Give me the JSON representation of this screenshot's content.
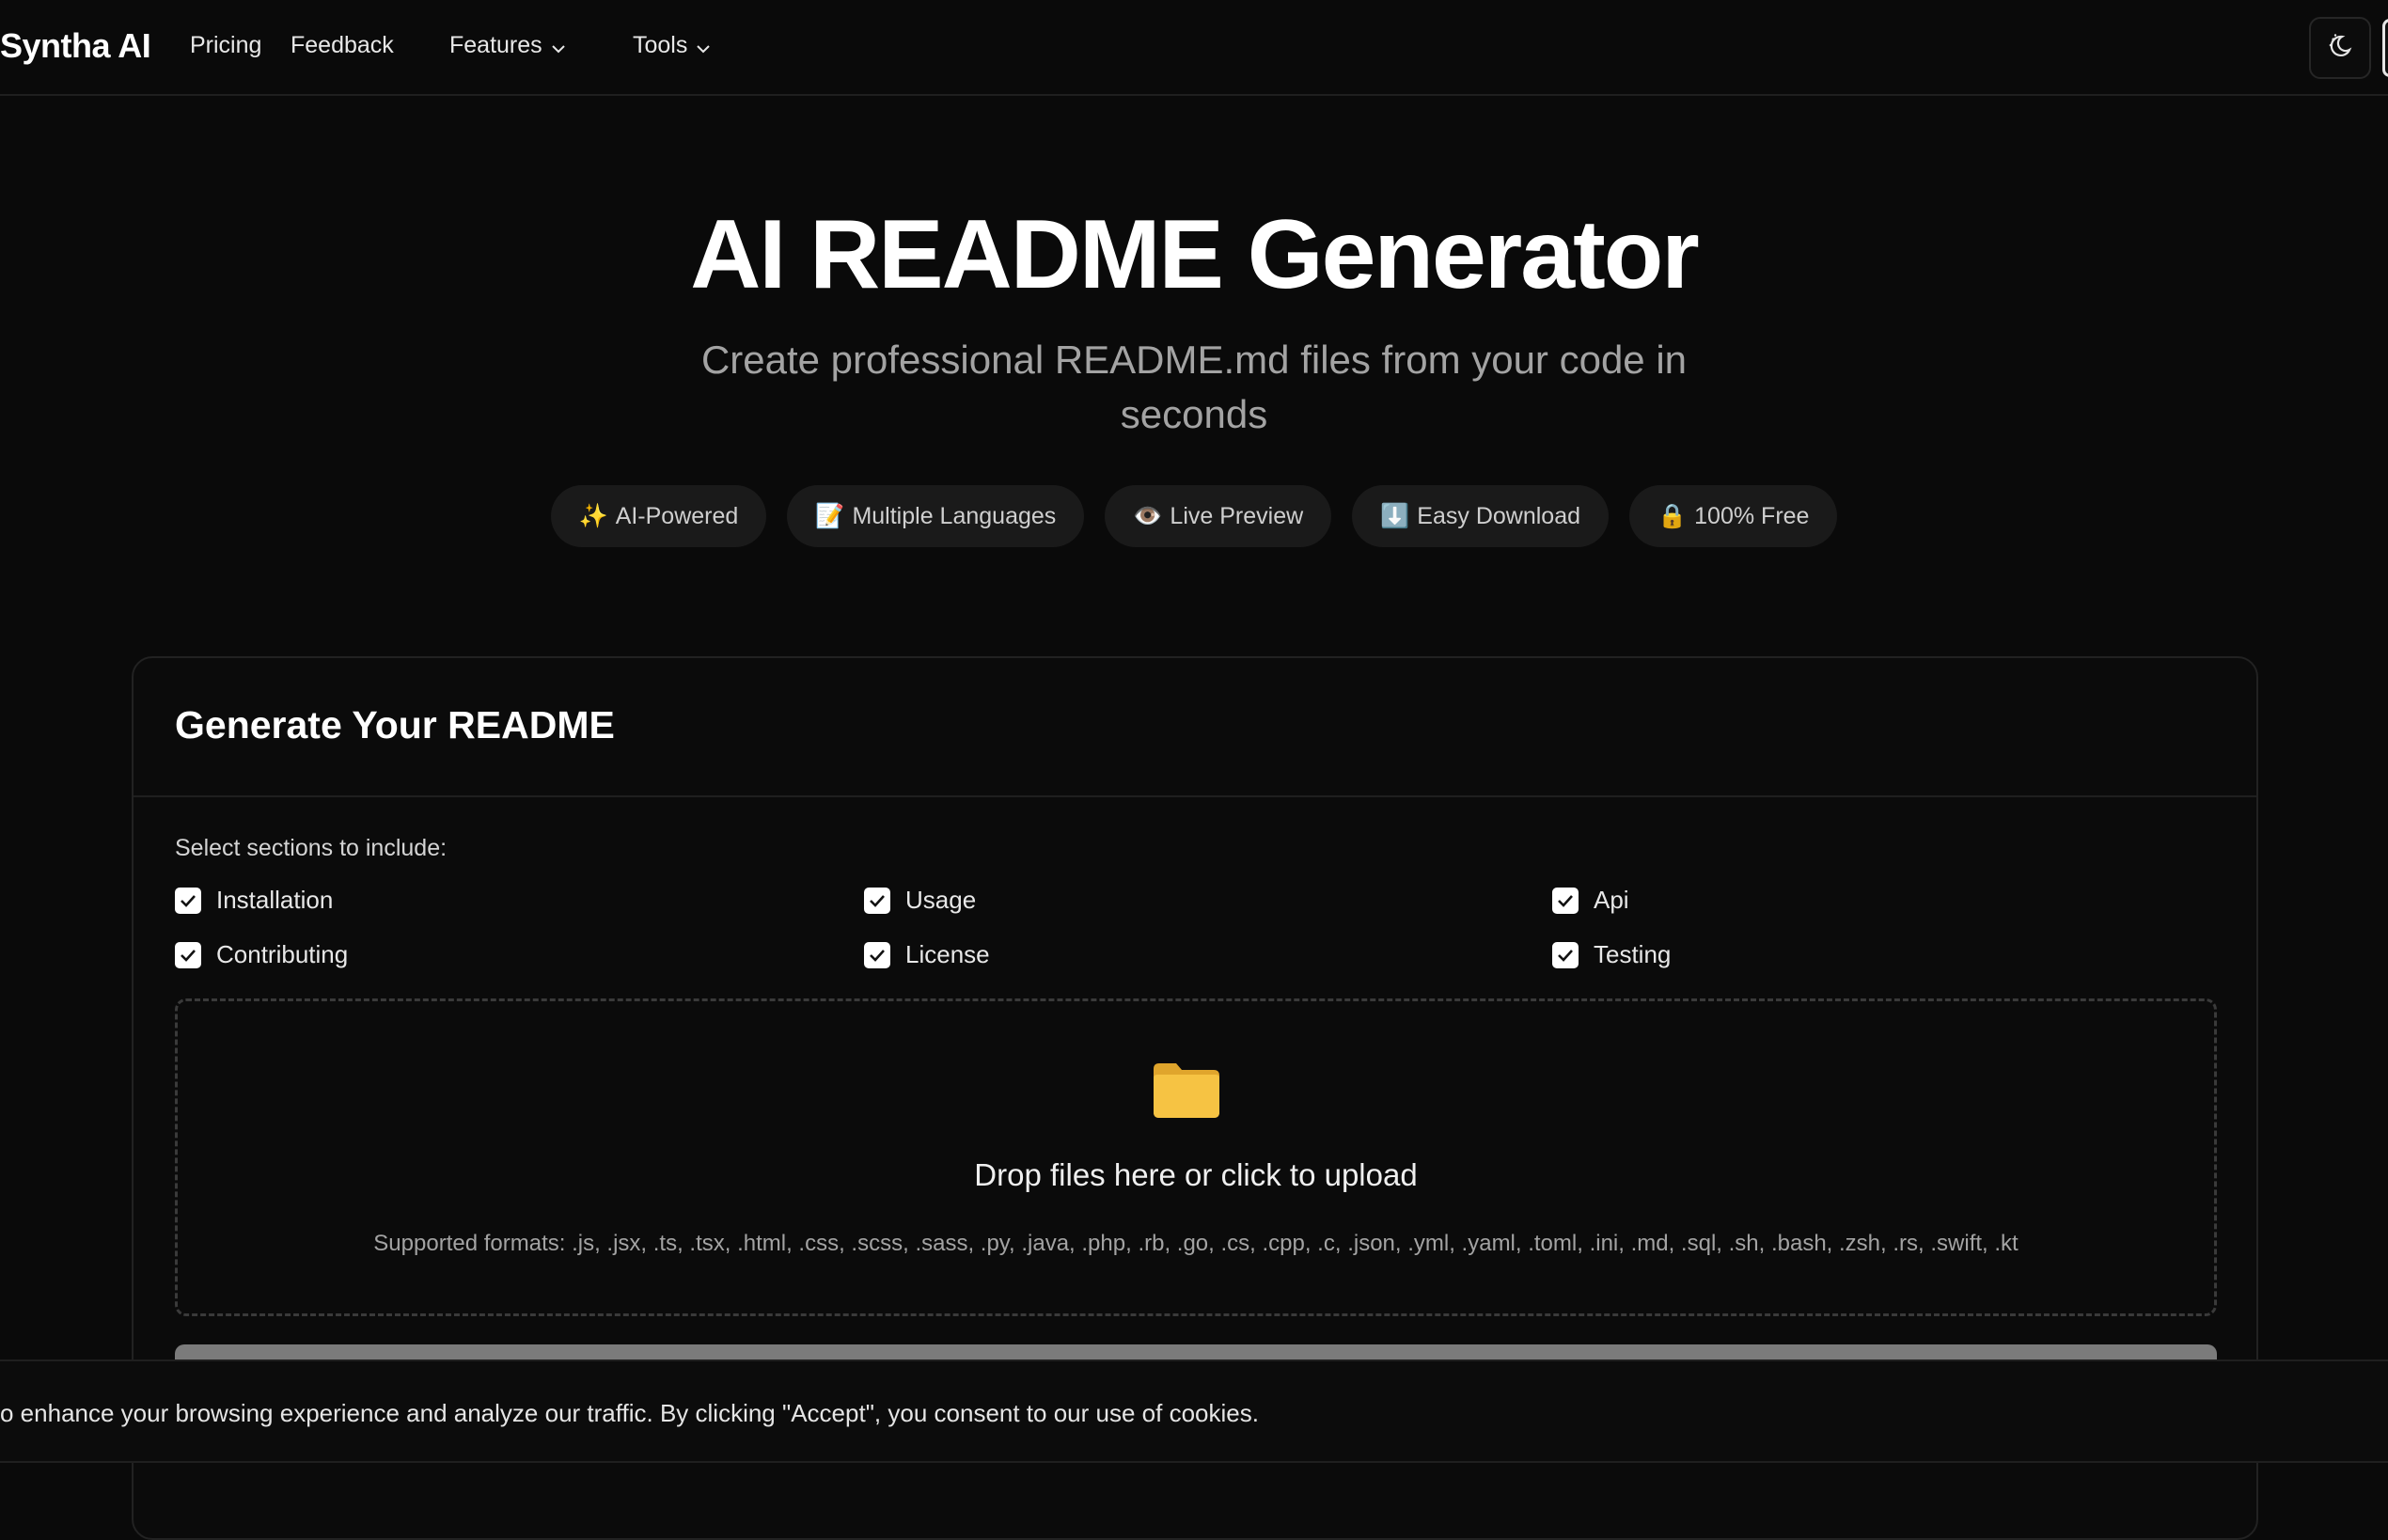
{
  "nav": {
    "brand": "Syntha AI",
    "links": {
      "pricing": "Pricing",
      "feedback": "Feedback",
      "features": "Features",
      "tools": "Tools"
    },
    "theme_toggle_icon": "moon-sun-icon"
  },
  "hero": {
    "title": "AI README Generator",
    "subtitle": "Create professional README.md files from your code in seconds",
    "pills": [
      {
        "emoji": "✨",
        "label": "AI-Powered"
      },
      {
        "emoji": "📝",
        "label": "Multiple Languages"
      },
      {
        "emoji": "👁️",
        "label": "Live Preview"
      },
      {
        "emoji": "⬇️",
        "label": "Easy Download"
      },
      {
        "emoji": "🔒",
        "label": "100% Free"
      }
    ]
  },
  "card": {
    "title": "Generate Your README",
    "sections_label": "Select sections to include:",
    "sections": [
      {
        "label": "Installation",
        "checked": true
      },
      {
        "label": "Usage",
        "checked": true
      },
      {
        "label": "Api",
        "checked": true
      },
      {
        "label": "Contributing",
        "checked": true
      },
      {
        "label": "License",
        "checked": true
      },
      {
        "label": "Testing",
        "checked": true
      }
    ],
    "dropzone": {
      "icon": "folder-icon",
      "title": "Drop files here or click to upload",
      "formats": "Supported formats: .js, .jsx, .ts, .tsx, .html, .css, .scss, .sass, .py, .java, .php, .rb, .go, .cs, .cpp, .c, .json, .yml, .yaml, .toml, .ini, .md, .sql, .sh, .bash, .zsh, .rs, .swift, .kt"
    }
  },
  "cookie": {
    "text": "o enhance your browsing experience and analyze our traffic. By clicking \"Accept\", you consent to our use of cookies."
  },
  "colors": {
    "background": "#0a0a0a",
    "pill_bg": "#1a1a1a",
    "muted_text": "#a3a3a3",
    "folder": "#f6c343"
  }
}
